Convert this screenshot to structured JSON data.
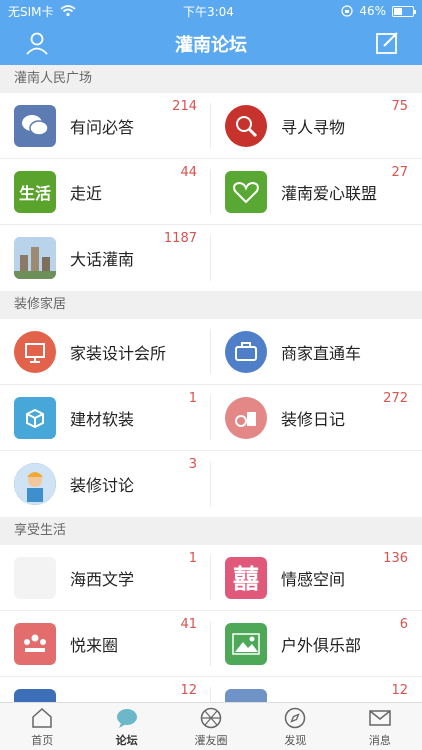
{
  "status": {
    "carrier": "无SIM卡",
    "time": "下午3:04",
    "battery": "46%",
    "battery_level": 0.46
  },
  "header": {
    "title": "灌南论坛"
  },
  "sections": [
    {
      "title": "灌南人民广场",
      "items": [
        {
          "label": "有问必答",
          "count": "214",
          "icon": "chat-bubbles-icon",
          "color": "#5b7bb2"
        },
        {
          "label": "寻人寻物",
          "count": "75",
          "icon": "search-globe-icon",
          "color": "#c7322c"
        },
        {
          "label": "走近",
          "count": "44",
          "icon": "text-logo-icon",
          "icon_text": "生活",
          "color": "#5aa42d"
        },
        {
          "label": "灌南爱心联盟",
          "count": "27",
          "icon": "heart-hand-icon",
          "color": "#59a833"
        },
        {
          "label": "大话灌南",
          "count": "1187",
          "icon": "city-photo-icon",
          "color": "#9ab8d4"
        }
      ]
    },
    {
      "title": "装修家居",
      "items": [
        {
          "label": "家装设计会所",
          "count": "",
          "icon": "presentation-icon",
          "color": "#e2624c"
        },
        {
          "label": "商家直通车",
          "count": "",
          "icon": "briefcase-icon",
          "color": "#4e7fc8"
        },
        {
          "label": "建材软装",
          "count": "1",
          "icon": "box-icon",
          "color": "#46a7d8"
        },
        {
          "label": "装修日记",
          "count": "272",
          "icon": "decor-icon",
          "color": "#e48787"
        },
        {
          "label": "装修讨论",
          "count": "3",
          "icon": "worker-icon",
          "color": "#3f8fcf"
        }
      ]
    },
    {
      "title": "享受生活",
      "items": [
        {
          "label": "海西文学",
          "count": "1",
          "icon": "blank-icon",
          "color": "#f3f3f3"
        },
        {
          "label": "情感空间",
          "count": "136",
          "icon": "double-happiness-icon",
          "icon_text": "囍",
          "color": "#e0587a"
        },
        {
          "label": "悦来圈",
          "count": "41",
          "icon": "group-meeting-icon",
          "color": "#e36d6d"
        },
        {
          "label": "户外俱乐部",
          "count": "6",
          "icon": "mountain-icon",
          "color": "#4da857"
        },
        {
          "label": "",
          "count": "12",
          "icon": "partial-icon",
          "color": "#3d6fb8"
        },
        {
          "label": "",
          "count": "12",
          "icon": "partial-icon",
          "color": "#6f93c6"
        }
      ]
    }
  ],
  "tabs": [
    {
      "label": "首页",
      "icon": "home-icon"
    },
    {
      "label": "论坛",
      "icon": "chat-icon",
      "active": true
    },
    {
      "label": "灌友圈",
      "icon": "aperture-icon"
    },
    {
      "label": "发现",
      "icon": "compass-icon"
    },
    {
      "label": "消息",
      "icon": "mail-icon"
    }
  ]
}
